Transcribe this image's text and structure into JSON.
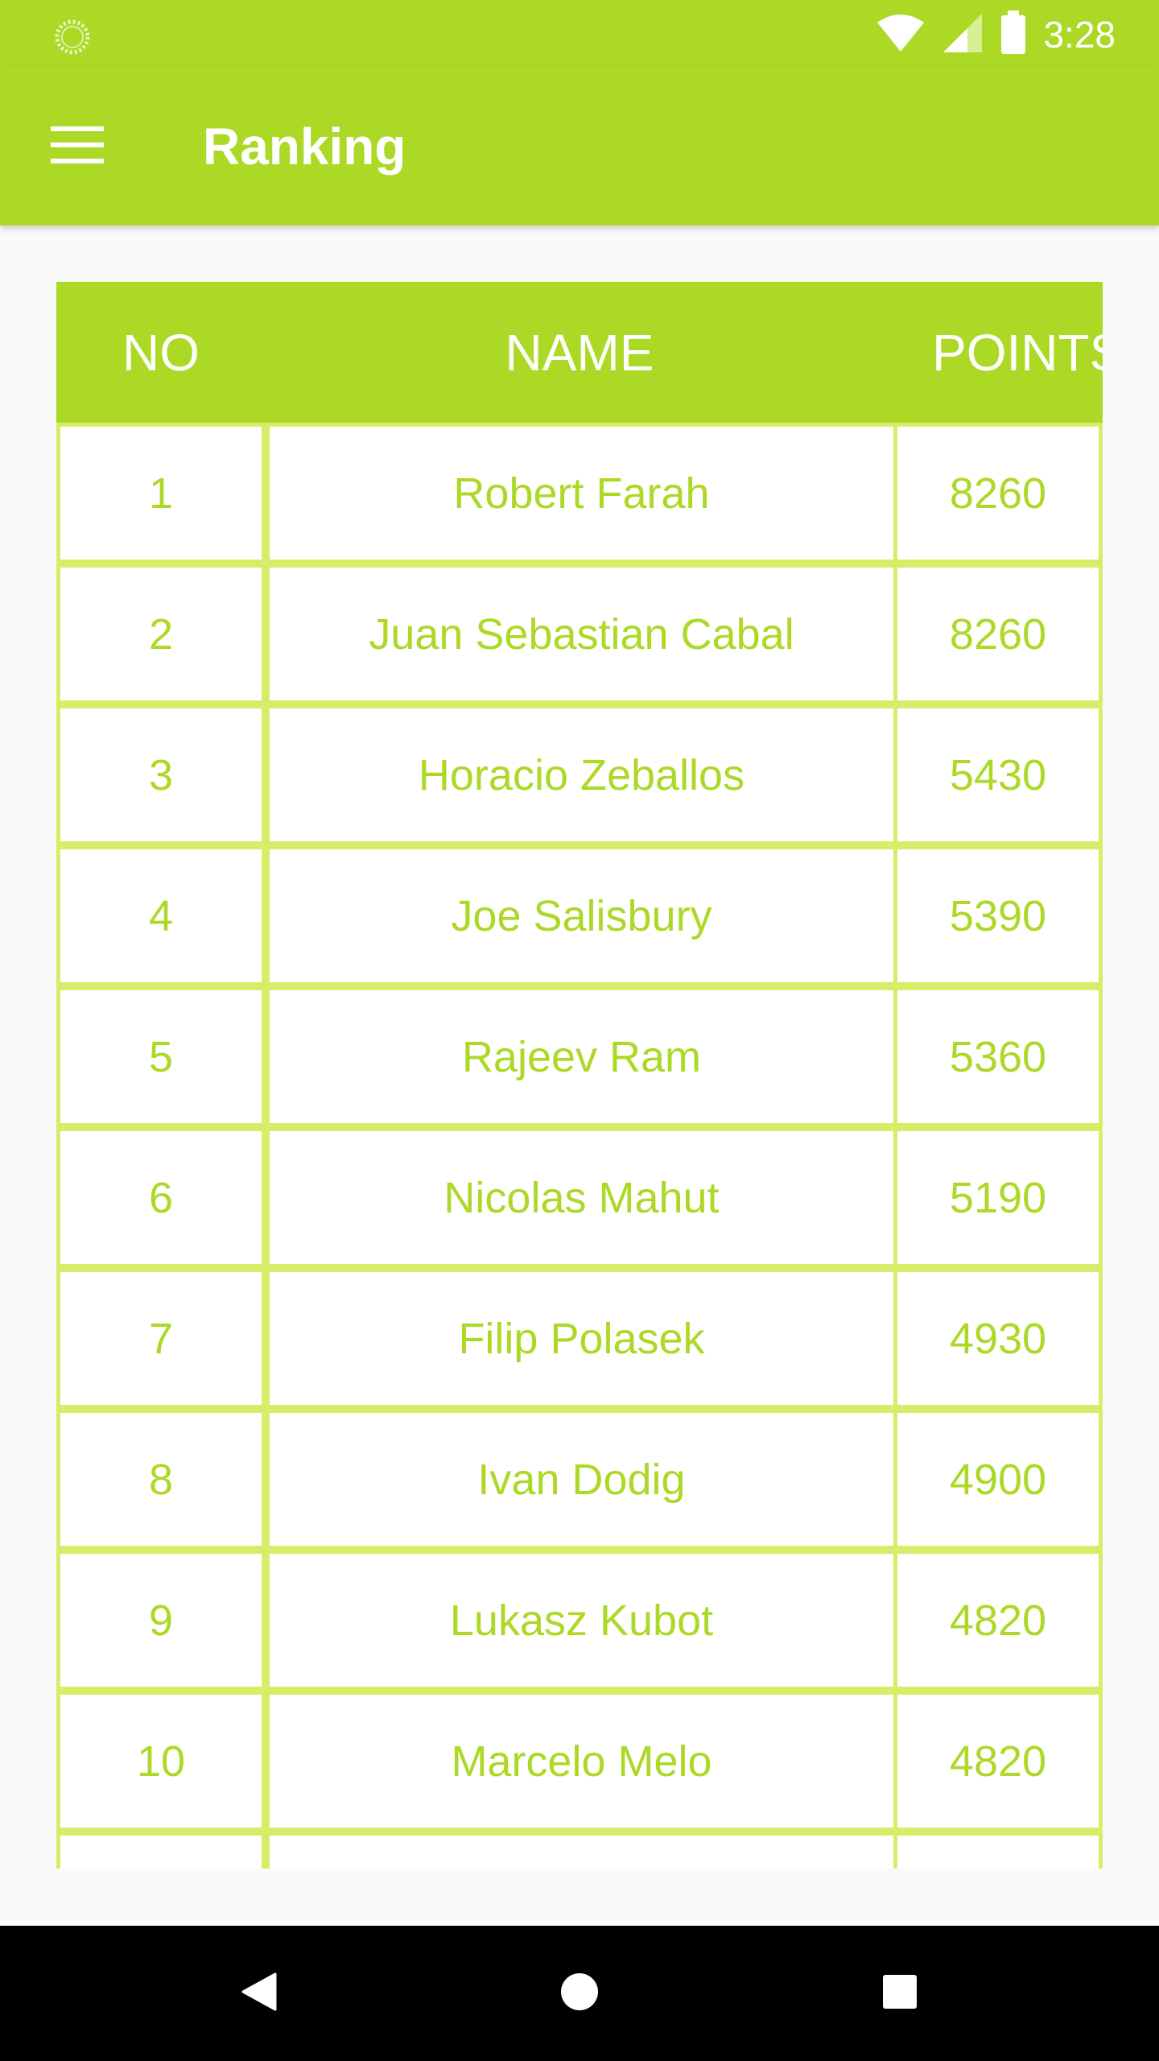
{
  "status_bar": {
    "time": "3:28",
    "icons": [
      "loading-spinner-icon",
      "wifi-icon",
      "cellular-signal-icon",
      "battery-icon"
    ]
  },
  "app_bar": {
    "title": "Ranking",
    "menu_icon": "hamburger-menu-icon"
  },
  "table": {
    "headers": [
      "NO",
      "NAME",
      "POINTS"
    ],
    "rows": [
      {
        "no": "1",
        "name": "Robert Farah",
        "points": "8260"
      },
      {
        "no": "2",
        "name": "Juan Sebastian Cabal",
        "points": "8260"
      },
      {
        "no": "3",
        "name": "Horacio Zeballos",
        "points": "5430"
      },
      {
        "no": "4",
        "name": "Joe Salisbury",
        "points": "5390"
      },
      {
        "no": "5",
        "name": "Rajeev Ram",
        "points": "5360"
      },
      {
        "no": "6",
        "name": "Nicolas Mahut",
        "points": "5190"
      },
      {
        "no": "7",
        "name": "Filip Polasek",
        "points": "4930"
      },
      {
        "no": "8",
        "name": "Ivan Dodig",
        "points": "4900"
      },
      {
        "no": "9",
        "name": "Lukasz Kubot",
        "points": "4820"
      },
      {
        "no": "10",
        "name": "Marcelo Melo",
        "points": "4820"
      },
      {
        "no": "",
        "name": "",
        "points": ""
      }
    ]
  },
  "nav_bar": {
    "buttons": [
      "back-icon",
      "home-icon",
      "recents-icon"
    ]
  },
  "colors": {
    "primary": "#abd926",
    "cell_border": "#d9ec6a",
    "cell_text": "#abd926",
    "background": "#fafafa",
    "nav_bar": "#000000"
  }
}
